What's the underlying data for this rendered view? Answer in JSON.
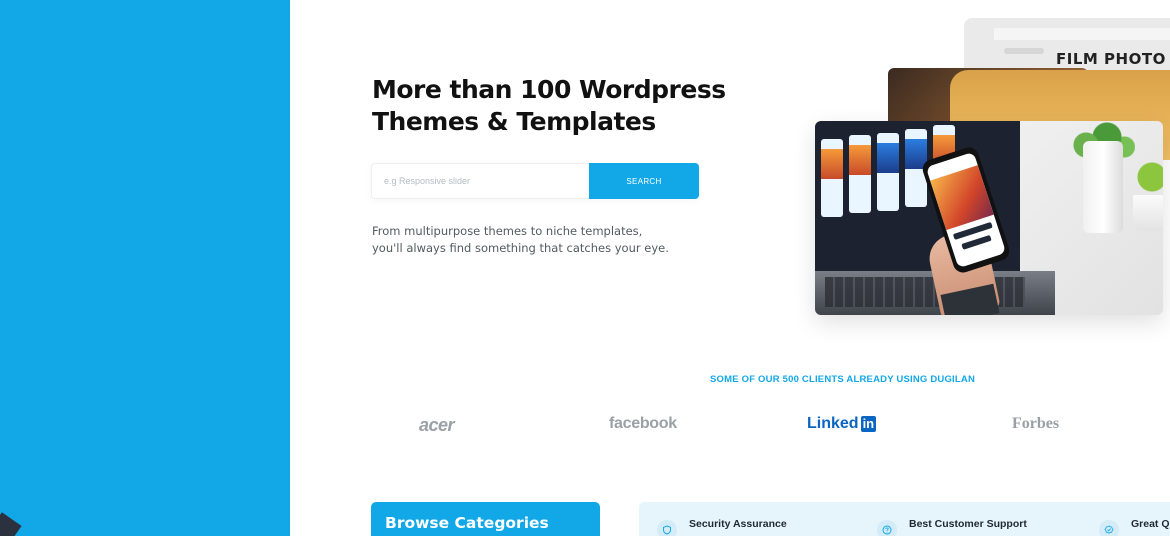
{
  "hero": {
    "title_line1": "More than 100 Wordpress",
    "title_line2": "Themes & Templates",
    "search_placeholder": "e.g Responsive slider",
    "search_button": "SEARCH",
    "desc_line1": "From multipurpose themes to niche templates,",
    "desc_line2": "you'll always find something that catches your eye.",
    "image_text": "FILM PHOTO"
  },
  "clients": {
    "heading": "SOME OF OUR 500 CLIENTS ALREADY USING DUGILAN",
    "logos": [
      {
        "name": "acer"
      },
      {
        "name": "facebook"
      },
      {
        "name": "Linked",
        "suffix": "in"
      },
      {
        "name": "Forbes"
      }
    ]
  },
  "browse": {
    "title": "Browse Categories"
  },
  "features": [
    {
      "label": "Security Assurance",
      "icon": "shield-icon"
    },
    {
      "label": "Best Customer Support",
      "icon": "help-circle-icon"
    },
    {
      "label": "Great Q",
      "icon": "badge-check-icon"
    }
  ],
  "colors": {
    "primary": "#12a8e8",
    "feature_bg": "#e6f4fb",
    "heading_text": "#111111",
    "logo_gray": "#9aa0a6",
    "linkedin": "#0a66c2"
  }
}
